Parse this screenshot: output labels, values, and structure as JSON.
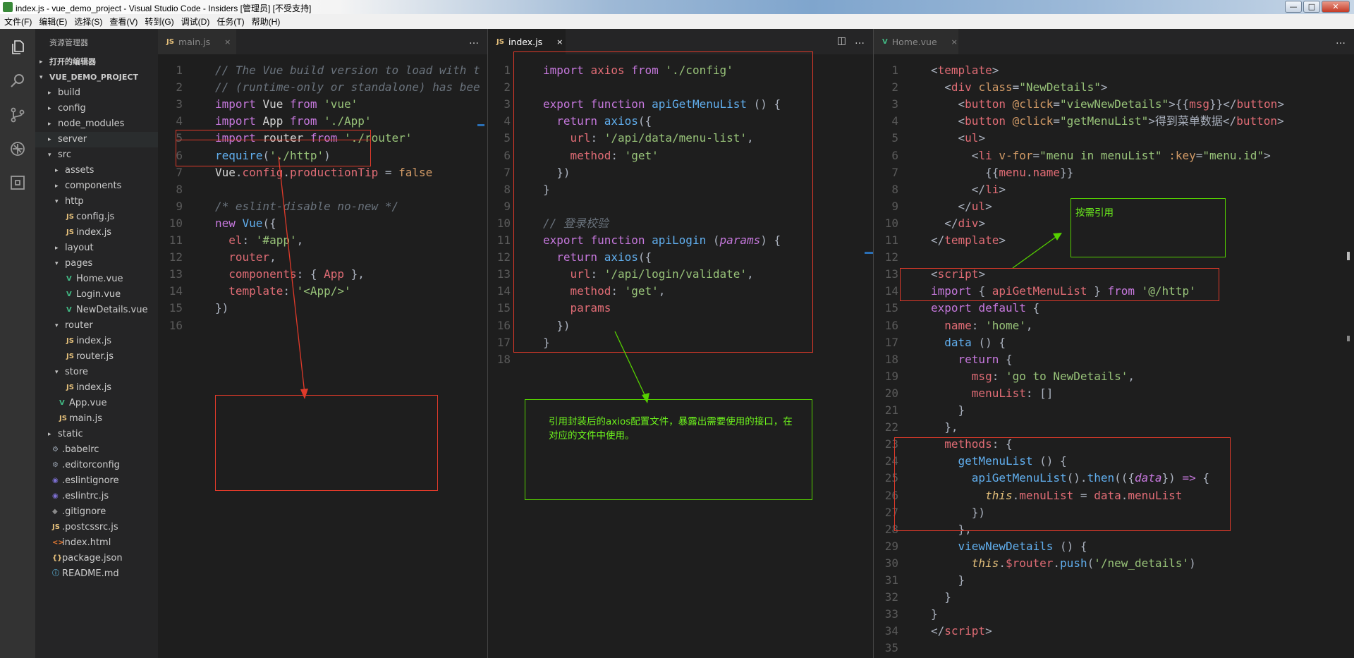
{
  "window": {
    "title": "index.js - vue_demo_project - Visual Studio Code - Insiders [管理员] [不受支持]",
    "controls": {
      "minimize": "—",
      "maximize": "□",
      "close": "✕"
    }
  },
  "menu": [
    "文件(F)",
    "编辑(E)",
    "选择(S)",
    "查看(V)",
    "转到(G)",
    "调试(D)",
    "任务(T)",
    "帮助(H)"
  ],
  "sidebar": {
    "title": "资源管理器",
    "tree": [
      {
        "label": "打开的编辑器",
        "depth": 0,
        "arrow": "▸",
        "icon": "",
        "section": true
      },
      {
        "label": "VUE_DEMO_PROJECT",
        "depth": 0,
        "arrow": "▾",
        "icon": "",
        "section": true
      },
      {
        "label": "build",
        "depth": 1,
        "arrow": "▸",
        "icon": ""
      },
      {
        "label": "config",
        "depth": 1,
        "arrow": "▸",
        "icon": ""
      },
      {
        "label": "node_modules",
        "depth": 1,
        "arrow": "▸",
        "icon": ""
      },
      {
        "label": "server",
        "depth": 1,
        "arrow": "▸",
        "icon": "",
        "highlight": true
      },
      {
        "label": "src",
        "depth": 1,
        "arrow": "▾",
        "icon": ""
      },
      {
        "label": "assets",
        "depth": 2,
        "arrow": "▸",
        "icon": ""
      },
      {
        "label": "components",
        "depth": 2,
        "arrow": "▸",
        "icon": ""
      },
      {
        "label": "http",
        "depth": 2,
        "arrow": "▾",
        "icon": ""
      },
      {
        "label": "config.js",
        "depth": 3,
        "arrow": "",
        "icon": "JS"
      },
      {
        "label": "index.js",
        "depth": 3,
        "arrow": "",
        "icon": "JS"
      },
      {
        "label": "layout",
        "depth": 2,
        "arrow": "▸",
        "icon": ""
      },
      {
        "label": "pages",
        "depth": 2,
        "arrow": "▾",
        "icon": ""
      },
      {
        "label": "Home.vue",
        "depth": 3,
        "arrow": "",
        "icon": "V"
      },
      {
        "label": "Login.vue",
        "depth": 3,
        "arrow": "",
        "icon": "V"
      },
      {
        "label": "NewDetails.vue",
        "depth": 3,
        "arrow": "",
        "icon": "V"
      },
      {
        "label": "router",
        "depth": 2,
        "arrow": "▾",
        "icon": ""
      },
      {
        "label": "index.js",
        "depth": 3,
        "arrow": "",
        "icon": "JS"
      },
      {
        "label": "router.js",
        "depth": 3,
        "arrow": "",
        "icon": "JS"
      },
      {
        "label": "store",
        "depth": 2,
        "arrow": "▾",
        "icon": ""
      },
      {
        "label": "index.js",
        "depth": 3,
        "arrow": "",
        "icon": "JS"
      },
      {
        "label": "App.vue",
        "depth": 2,
        "arrow": "",
        "icon": "V"
      },
      {
        "label": "main.js",
        "depth": 2,
        "arrow": "",
        "icon": "JS"
      },
      {
        "label": "static",
        "depth": 1,
        "arrow": "▸",
        "icon": ""
      },
      {
        "label": ".babelrc",
        "depth": 1,
        "arrow": "",
        "icon": "⚙"
      },
      {
        "label": ".editorconfig",
        "depth": 1,
        "arrow": "",
        "icon": "⚙"
      },
      {
        "label": ".eslintignore",
        "depth": 1,
        "arrow": "",
        "icon": "◉"
      },
      {
        "label": ".eslintrc.js",
        "depth": 1,
        "arrow": "",
        "icon": "◉"
      },
      {
        "label": ".gitignore",
        "depth": 1,
        "arrow": "",
        "icon": "◆"
      },
      {
        "label": ".postcssrc.js",
        "depth": 1,
        "arrow": "",
        "icon": "JS"
      },
      {
        "label": "index.html",
        "depth": 1,
        "arrow": "",
        "icon": "<>"
      },
      {
        "label": "package.json",
        "depth": 1,
        "arrow": "",
        "icon": "{}"
      },
      {
        "label": "README.md",
        "depth": 1,
        "arrow": "",
        "icon": "ⓘ"
      }
    ]
  },
  "editors": [
    {
      "tab": {
        "icon": "JS",
        "label": "main.js",
        "close": "×",
        "active": false
      },
      "tools": [
        "…"
      ],
      "code": [
        [
          [
            "// The Vue build version to load with t",
            "com"
          ]
        ],
        [
          [
            "// (runtime-only or standalone) has bee",
            "com"
          ]
        ],
        [
          [
            "import ",
            "kw"
          ],
          [
            "Vue ",
            "def"
          ],
          [
            "from ",
            "kw"
          ],
          [
            "'vue'",
            "str"
          ]
        ],
        [
          [
            "import ",
            "kw"
          ],
          [
            "App ",
            "def"
          ],
          [
            "from ",
            "kw"
          ],
          [
            "'./App'",
            "str"
          ]
        ],
        [
          [
            "import ",
            "kw"
          ],
          [
            "router ",
            "def"
          ],
          [
            "from ",
            "kw"
          ],
          [
            "'./router'",
            "str"
          ]
        ],
        [
          [
            "require",
            "fn"
          ],
          [
            "(",
            "pun"
          ],
          [
            "'./http'",
            "str"
          ],
          [
            ")",
            "pun"
          ]
        ],
        [
          [
            "Vue",
            "def"
          ],
          [
            ".",
            "pun"
          ],
          [
            "config",
            "prop"
          ],
          [
            ".",
            "pun"
          ],
          [
            "productionTip",
            "prop"
          ],
          [
            " = ",
            "pun"
          ],
          [
            "false",
            "num"
          ]
        ],
        [],
        [
          [
            "/* eslint-disable no-new */",
            "com"
          ]
        ],
        [
          [
            "new ",
            "kw"
          ],
          [
            "Vue",
            "fn"
          ],
          [
            "({",
            "pun"
          ]
        ],
        [
          [
            "  el",
            "prop"
          ],
          [
            ": ",
            "pun"
          ],
          [
            "'#app'",
            "str"
          ],
          [
            ",",
            "pun"
          ]
        ],
        [
          [
            "  router",
            "prop"
          ],
          [
            ",",
            "pun"
          ]
        ],
        [
          [
            "  components",
            "prop"
          ],
          [
            ": { ",
            "pun"
          ],
          [
            "App",
            "prop"
          ],
          [
            " },",
            "pun"
          ]
        ],
        [
          [
            "  template",
            "prop"
          ],
          [
            ": ",
            "pun"
          ],
          [
            "'<App/>'",
            "str"
          ]
        ],
        [
          [
            "})",
            "pun"
          ]
        ],
        []
      ]
    },
    {
      "tab": {
        "icon": "JS",
        "label": "index.js",
        "close": "×",
        "active": true
      },
      "tools": [
        "◫",
        "…"
      ],
      "code": [
        [
          [
            "import ",
            "kw"
          ],
          [
            "axios ",
            "prop"
          ],
          [
            "from ",
            "kw"
          ],
          [
            "'./config'",
            "str"
          ]
        ],
        [],
        [
          [
            "export ",
            "kw"
          ],
          [
            "function ",
            "kw"
          ],
          [
            "apiGetMenuList",
            "fn"
          ],
          [
            " () {",
            "pun"
          ]
        ],
        [
          [
            "  return ",
            "kw"
          ],
          [
            "axios",
            "fn"
          ],
          [
            "({",
            "pun"
          ]
        ],
        [
          [
            "    url",
            "prop"
          ],
          [
            ": ",
            "pun"
          ],
          [
            "'/api/data/menu-list'",
            "str"
          ],
          [
            ",",
            "pun"
          ]
        ],
        [
          [
            "    method",
            "prop"
          ],
          [
            ": ",
            "pun"
          ],
          [
            "'get'",
            "str"
          ]
        ],
        [
          [
            "  })",
            "pun"
          ]
        ],
        [
          [
            "}",
            "pun"
          ]
        ],
        [],
        [
          [
            "// 登录校验",
            "com"
          ]
        ],
        [
          [
            "export ",
            "kw"
          ],
          [
            "function ",
            "kw"
          ],
          [
            "apiLogin",
            "fn"
          ],
          [
            " (",
            "pun"
          ],
          [
            "params",
            "par"
          ],
          [
            ") {",
            "pun"
          ]
        ],
        [
          [
            "  return ",
            "kw"
          ],
          [
            "axios",
            "fn"
          ],
          [
            "({",
            "pun"
          ]
        ],
        [
          [
            "    url",
            "prop"
          ],
          [
            ": ",
            "pun"
          ],
          [
            "'/api/login/validate'",
            "str"
          ],
          [
            ",",
            "pun"
          ]
        ],
        [
          [
            "    method",
            "prop"
          ],
          [
            ": ",
            "pun"
          ],
          [
            "'get'",
            "str"
          ],
          [
            ",",
            "pun"
          ]
        ],
        [
          [
            "    params",
            "prop"
          ]
        ],
        [
          [
            "  })",
            "pun"
          ]
        ],
        [
          [
            "}",
            "pun"
          ]
        ],
        []
      ]
    },
    {
      "tab": {
        "icon": "V",
        "label": "Home.vue",
        "close": "×",
        "active": false
      },
      "tools": [
        "…"
      ],
      "code": [
        [
          [
            "<",
            "pun"
          ],
          [
            "template",
            "tag"
          ],
          [
            ">",
            "pun"
          ]
        ],
        [
          [
            "  <",
            "pun"
          ],
          [
            "div ",
            "tag"
          ],
          [
            "class",
            "attr"
          ],
          [
            "=",
            "pun"
          ],
          [
            "\"NewDetails\"",
            "str"
          ],
          [
            ">",
            "pun"
          ]
        ],
        [
          [
            "    <",
            "pun"
          ],
          [
            "button ",
            "tag"
          ],
          [
            "@click",
            "attr"
          ],
          [
            "=",
            "pun"
          ],
          [
            "\"viewNewDetails\"",
            "str"
          ],
          [
            ">{{",
            "pun"
          ],
          [
            "msg",
            "prop"
          ],
          [
            "}}</",
            "pun"
          ],
          [
            "button",
            "tag"
          ],
          [
            ">",
            "pun"
          ]
        ],
        [
          [
            "    <",
            "pun"
          ],
          [
            "button ",
            "tag"
          ],
          [
            "@click",
            "attr"
          ],
          [
            "=",
            "pun"
          ],
          [
            "\"getMenuList\"",
            "str"
          ],
          [
            ">得到菜单数据</",
            "pun"
          ],
          [
            "button",
            "tag"
          ],
          [
            ">",
            "pun"
          ]
        ],
        [
          [
            "    <",
            "pun"
          ],
          [
            "ul",
            "tag"
          ],
          [
            ">",
            "pun"
          ]
        ],
        [
          [
            "      <",
            "pun"
          ],
          [
            "li ",
            "tag"
          ],
          [
            "v-for",
            "attr"
          ],
          [
            "=",
            "pun"
          ],
          [
            "\"menu in menuList\"",
            "str"
          ],
          [
            " ",
            "pun"
          ],
          [
            ":key",
            "attr"
          ],
          [
            "=",
            "pun"
          ],
          [
            "\"menu.id\"",
            "str"
          ],
          [
            ">",
            "pun"
          ]
        ],
        [
          [
            "        {{",
            "pun"
          ],
          [
            "menu",
            "prop"
          ],
          [
            ".",
            "pun"
          ],
          [
            "name",
            "prop"
          ],
          [
            "}}",
            "pun"
          ]
        ],
        [
          [
            "      </",
            "pun"
          ],
          [
            "li",
            "tag"
          ],
          [
            ">",
            "pun"
          ]
        ],
        [
          [
            "    </",
            "pun"
          ],
          [
            "ul",
            "tag"
          ],
          [
            ">",
            "pun"
          ]
        ],
        [
          [
            "  </",
            "pun"
          ],
          [
            "div",
            "tag"
          ],
          [
            ">",
            "pun"
          ]
        ],
        [
          [
            "</",
            "pun"
          ],
          [
            "template",
            "tag"
          ],
          [
            ">",
            "pun"
          ]
        ],
        [],
        [
          [
            "<",
            "pun"
          ],
          [
            "script",
            "tag"
          ],
          [
            ">",
            "pun"
          ]
        ],
        [
          [
            "import ",
            "kw"
          ],
          [
            "{ ",
            "pun"
          ],
          [
            "apiGetMenuList",
            "prop"
          ],
          [
            " } ",
            "pun"
          ],
          [
            "from ",
            "kw"
          ],
          [
            "'@/http'",
            "str"
          ]
        ],
        [
          [
            "export ",
            "kw"
          ],
          [
            "default ",
            "kw"
          ],
          [
            "{",
            "pun"
          ]
        ],
        [
          [
            "  name",
            "prop"
          ],
          [
            ": ",
            "pun"
          ],
          [
            "'home'",
            "str"
          ],
          [
            ",",
            "pun"
          ]
        ],
        [
          [
            "  data ",
            "fn"
          ],
          [
            "() {",
            "pun"
          ]
        ],
        [
          [
            "    return ",
            "kw"
          ],
          [
            "{",
            "pun"
          ]
        ],
        [
          [
            "      msg",
            "prop"
          ],
          [
            ": ",
            "pun"
          ],
          [
            "'go to NewDetails'",
            "str"
          ],
          [
            ",",
            "pun"
          ]
        ],
        [
          [
            "      menuList",
            "prop"
          ],
          [
            ": []",
            "pun"
          ]
        ],
        [
          [
            "    }",
            "pun"
          ]
        ],
        [
          [
            "  },",
            "pun"
          ]
        ],
        [
          [
            "  methods",
            "prop"
          ],
          [
            ": {",
            "pun"
          ]
        ],
        [
          [
            "    getMenuList ",
            "fn"
          ],
          [
            "() {",
            "pun"
          ]
        ],
        [
          [
            "      apiGetMenuList",
            "fn"
          ],
          [
            "().",
            "pun"
          ],
          [
            "then",
            "fn"
          ],
          [
            "(({",
            "pun"
          ],
          [
            "data",
            "par"
          ],
          [
            "}) ",
            "pun"
          ],
          [
            "=> ",
            "kw"
          ],
          [
            "{",
            "pun"
          ]
        ],
        [
          [
            "        this",
            "this"
          ],
          [
            ".",
            "pun"
          ],
          [
            "menuList",
            "prop"
          ],
          [
            " = ",
            "pun"
          ],
          [
            "data",
            "prop"
          ],
          [
            ".",
            "pun"
          ],
          [
            "menuList",
            "prop"
          ]
        ],
        [
          [
            "      })",
            "pun"
          ]
        ],
        [
          [
            "    },",
            "pun"
          ]
        ],
        [
          [
            "    viewNewDetails ",
            "fn"
          ],
          [
            "() {",
            "pun"
          ]
        ],
        [
          [
            "      this",
            "this"
          ],
          [
            ".",
            "pun"
          ],
          [
            "$router",
            "prop"
          ],
          [
            ".",
            "pun"
          ],
          [
            "push",
            "fn"
          ],
          [
            "(",
            "pun"
          ],
          [
            "'/new_details'",
            "str"
          ],
          [
            ")",
            "pun"
          ]
        ],
        [
          [
            "    }",
            "pun"
          ]
        ],
        [
          [
            "  }",
            "pun"
          ]
        ],
        [
          [
            "}",
            "pun"
          ]
        ],
        [
          [
            "</",
            "pun"
          ],
          [
            "script",
            "tag"
          ],
          [
            ">",
            "pun"
          ]
        ],
        []
      ]
    }
  ],
  "annotations": {
    "note_center": "引用封装后的axios配置文件，暴露出需要使用的接口，在对应的文件中使用。",
    "note_right": "按需引用"
  },
  "colors": {
    "annotation_red": "#e03a2a",
    "annotation_green": "#55d000",
    "note_text": "#6df21d",
    "editor_bg": "#1e1e1e",
    "sidebar_bg": "#252526",
    "activity_bg": "#333333"
  }
}
